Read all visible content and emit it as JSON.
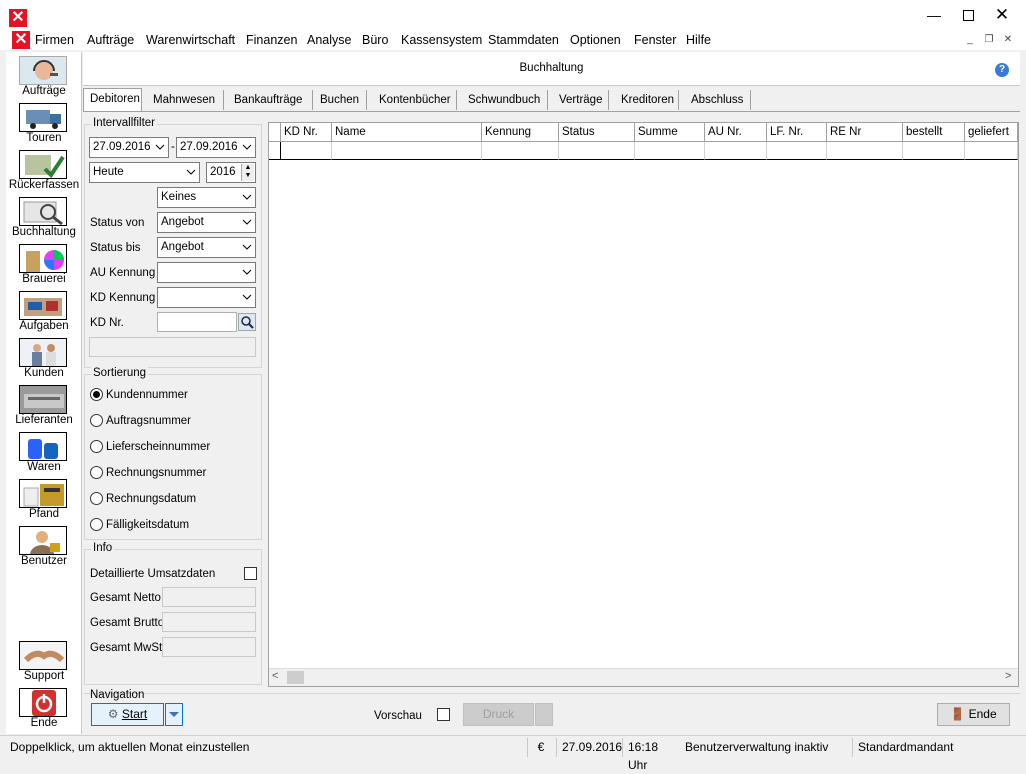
{
  "menu": [
    "Firmen",
    "Aufträge",
    "Warenwirtschaft",
    "Finanzen",
    "Analyse",
    "Büro",
    "Kassensystem",
    "Stammdaten",
    "Optionen",
    "Fenster",
    "Hilfe"
  ],
  "sidebar": [
    {
      "label": "Aufträge",
      "icon": "headset-operator-icon"
    },
    {
      "label": "Touren",
      "icon": "truck-icon"
    },
    {
      "label": "Rückerfassen",
      "icon": "return-checklist-icon"
    },
    {
      "label": "Buchhaltung",
      "icon": "accounting-magnifier-icon"
    },
    {
      "label": "Brauerei",
      "icon": "brewery-icon"
    },
    {
      "label": "Aufgaben",
      "icon": "tasks-icon"
    },
    {
      "label": "Kunden",
      "icon": "customers-icon"
    },
    {
      "label": "Lieferanten",
      "icon": "suppliers-icon"
    },
    {
      "label": "Waren",
      "icon": "goods-icon"
    },
    {
      "label": "Pfand",
      "icon": "deposit-crates-icon"
    },
    {
      "label": "Benutzer",
      "icon": "user-lock-icon"
    },
    {
      "label": "Support",
      "icon": "handshake-icon"
    },
    {
      "label": "Ende",
      "icon": "power-icon"
    }
  ],
  "header": {
    "title": "Buchhaltung"
  },
  "tabs": [
    "Debitoren",
    "Mahnwesen",
    "Bankaufträge",
    "Buchen",
    "Kontenbücher",
    "Schwundbuch",
    "Verträge",
    "Kreditoren",
    "Abschluss"
  ],
  "filter": {
    "group_title": "Intervallfilter",
    "date_from": "27.09.2016",
    "date_to": "27.09.2016",
    "date_sep": "-",
    "period": "Heute",
    "year": "2016",
    "keines": "Keines",
    "status_von_label": "Status von",
    "status_von": "Angebot",
    "status_bis_label": "Status bis",
    "status_bis": "Angebot",
    "au_kennung_label": "AU Kennung",
    "au_kennung": "",
    "kd_kennung_label": "KD Kennung",
    "kd_kennung": "",
    "kd_nr_label": "KD Nr.",
    "kd_nr": ""
  },
  "sort": {
    "title": "Sortierung",
    "options": [
      "Kundennummer",
      "Auftragsnummer",
      "Lieferscheinnummer",
      "Rechnungsnummer",
      "Rechnungsdatum",
      "Fälligkeitsdatum"
    ],
    "selected": "Kundennummer"
  },
  "info": {
    "title": "Info",
    "detail_label": "Detaillierte Umsatzdaten",
    "netto_label": "Gesamt Netto",
    "brutto_label": "Gesamt Brutto",
    "mwst_label": "Gesamt MwSt."
  },
  "grid": {
    "columns": [
      "KD Nr.",
      "Name",
      "Kennung",
      "Status",
      "Summe",
      "AU Nr.",
      "LF. Nr.",
      "RE Nr",
      "bestellt",
      "geliefert"
    ]
  },
  "navigation": {
    "title": "Navigation",
    "start_label": "Start",
    "vorschau_label": "Vorschau",
    "druck_label": "Druck",
    "ende_label": "Ende"
  },
  "status": {
    "hint": "Doppelklick, um aktuellen Monat einzustellen",
    "currency": "€",
    "date": "27.09.2016",
    "time": "16:18 Uhr",
    "userinfo": "Benutzerverwaltung inaktiv",
    "mandant": "Standardmandant"
  }
}
